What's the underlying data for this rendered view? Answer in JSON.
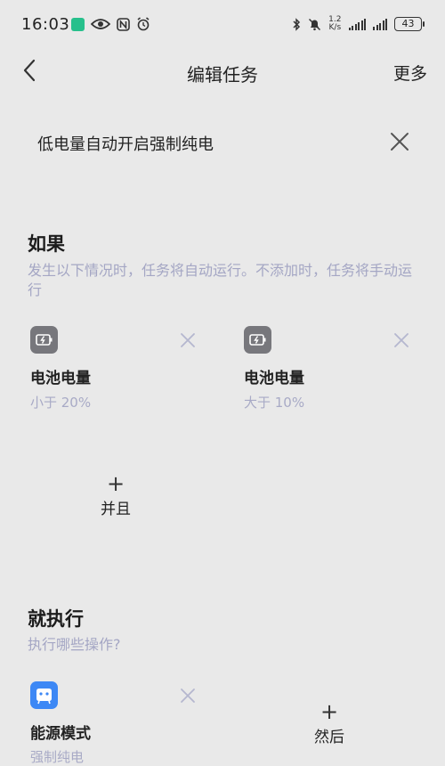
{
  "status_bar": {
    "time": "16:03",
    "net_speed_value": "1.2",
    "net_speed_unit": "K/s",
    "battery_level": "43"
  },
  "header": {
    "title": "编辑任务",
    "more_label": "更多"
  },
  "task": {
    "name": "低电量自动开启强制纯电"
  },
  "if_section": {
    "title": "如果",
    "description": "发生以下情况时，任务将自动运行。不添加时，任务将手动运行",
    "conditions": [
      {
        "title": "电池电量",
        "subtitle": "小于 20%",
        "icon": "battery-charge-icon"
      },
      {
        "title": "电池电量",
        "subtitle": "大于 10%",
        "icon": "battery-charge-icon"
      }
    ],
    "add_label": "并且"
  },
  "then_section": {
    "title": "就执行",
    "description": "执行哪些操作?",
    "actions": [
      {
        "title": "能源模式",
        "subtitle": "强制纯电",
        "icon": "energy-mode-icon"
      }
    ],
    "add_label": "然后"
  },
  "colors": {
    "background": "#e9e9e9",
    "hint_text": "#a4a6c4",
    "condition_icon": "#77777c",
    "action_icon": "#3d88f5"
  }
}
